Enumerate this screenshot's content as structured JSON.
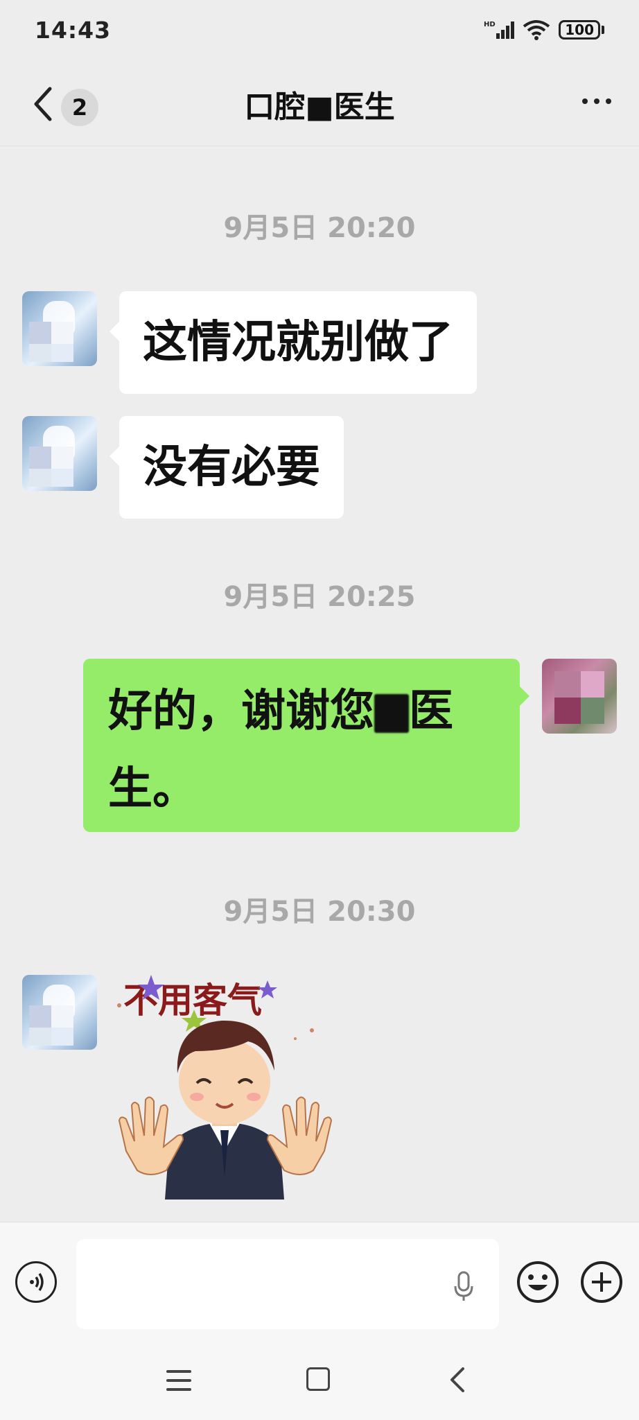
{
  "status_bar": {
    "time": "14:43",
    "network": "HD",
    "battery": "100"
  },
  "header": {
    "unread_count": "2",
    "title": "口腔■医生"
  },
  "messages": [
    {
      "timestamp": "9月5日 20:20"
    },
    {
      "sender": "doctor",
      "text": "这情况就别做了"
    },
    {
      "sender": "doctor",
      "text": "没有必要"
    },
    {
      "timestamp": "9月5日 20:25"
    },
    {
      "sender": "me",
      "text_before": "好的，谢谢您",
      "text_after": "医生。"
    },
    {
      "timestamp": "9月5日 20:30"
    },
    {
      "sender": "doctor",
      "type": "sticker",
      "sticker_text": "不用客气"
    }
  ],
  "input_bar": {
    "placeholder": ""
  },
  "icons": [
    "back-icon",
    "more-icon",
    "voice-icon",
    "mic-icon",
    "emoji-icon",
    "plus-icon",
    "nav-menu-icon",
    "nav-home-icon",
    "nav-back-icon"
  ],
  "colors": {
    "background": "#ededed",
    "my_bubble": "#95ec69",
    "their_bubble": "#ffffff",
    "timestamp": "#a8a8a8"
  }
}
